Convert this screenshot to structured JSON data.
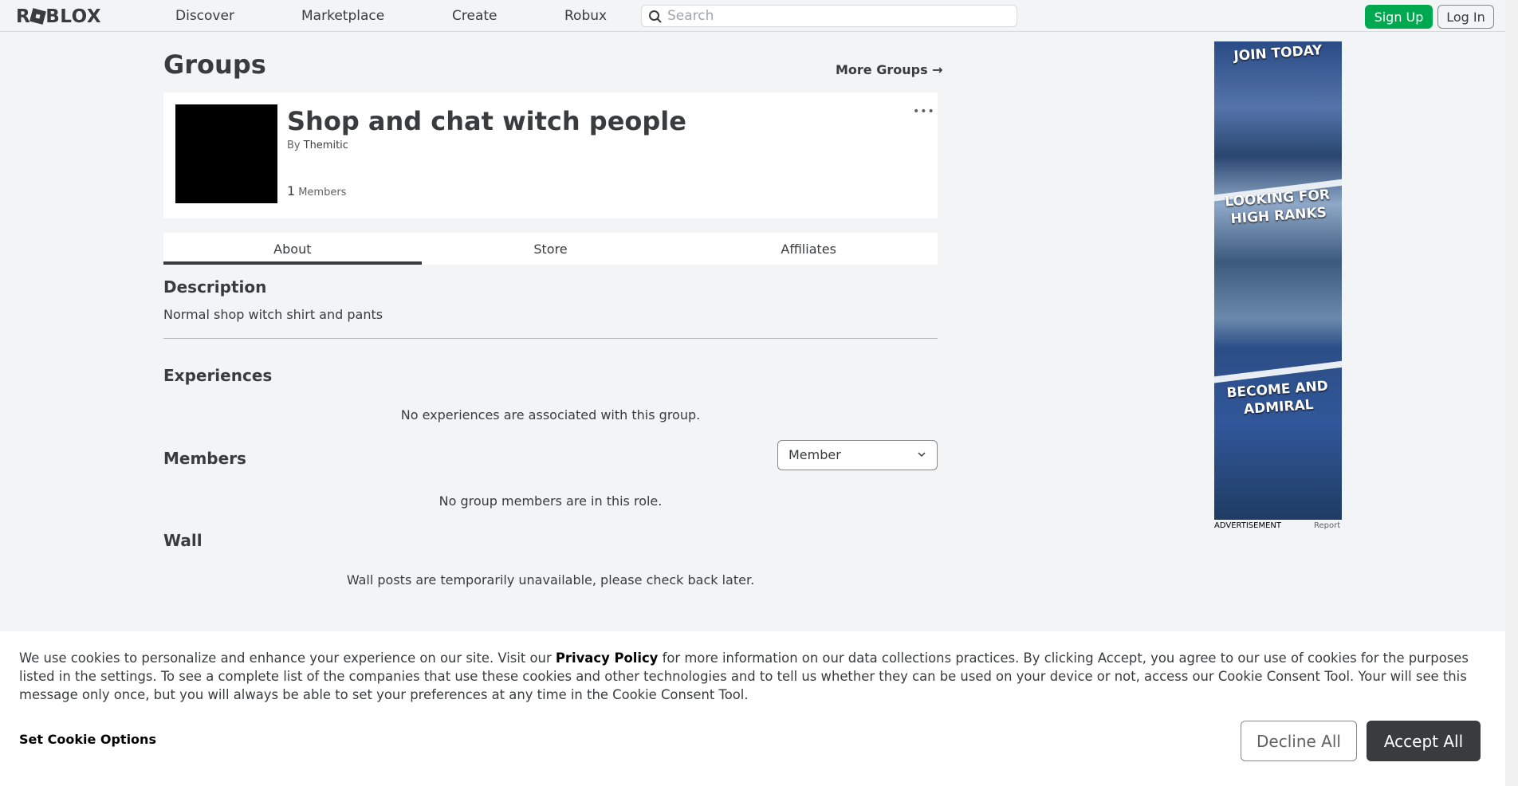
{
  "header": {
    "logo": "ROBLOX",
    "nav": [
      "Discover",
      "Marketplace",
      "Create",
      "Robux"
    ],
    "search_placeholder": "Search",
    "signup_label": "Sign Up",
    "login_label": "Log In"
  },
  "page": {
    "title": "Groups",
    "more_groups": "More Groups →"
  },
  "group": {
    "name": "Shop and chat witch people",
    "by_label": "By",
    "owner": "Themitic",
    "member_count": "1",
    "members_label": "Members",
    "menu": "•••"
  },
  "tabs": [
    {
      "label": "About",
      "active": true
    },
    {
      "label": "Store",
      "active": false
    },
    {
      "label": "Affiliates",
      "active": false
    }
  ],
  "about": {
    "description_heading": "Description",
    "description": "Normal shop witch shirt and pants",
    "experiences_heading": "Experiences",
    "experiences_empty": "No experiences are associated with this group.",
    "members_heading": "Members",
    "role_selected": "Member",
    "members_empty": "No group members are in this role.",
    "wall_heading": "Wall",
    "wall_message": "Wall posts are temporarily unavailable, please check back later."
  },
  "ad": {
    "panel1": "JOIN TODAY",
    "panel2": "LOOKING FOR HIGH RANKS",
    "panel3": "BECOME AND ADMIRAL",
    "label": "ADVERTISEMENT",
    "report": "Report"
  },
  "cookie": {
    "text_before": "We use cookies to personalize and enhance your experience on our site. Visit our ",
    "privacy_link": "Privacy Policy",
    "text_after": " for more information on our data collections practices. By clicking Accept, you agree to our use of cookies for the purposes listed in the settings. To see a complete list of the companies that use these cookies and other technologies and to tell us whether they can be used on your device or not, access our Cookie Consent Tool. Your will see this message only once, but you will always be able to set your preferences at any time in the Cookie Consent Tool.",
    "set_options": "Set Cookie Options",
    "decline": "Decline All",
    "accept": "Accept All"
  },
  "colors": {
    "background": "#f2f4f5",
    "signup_green": "#00a84f",
    "accept_dark": "#393b3d"
  }
}
